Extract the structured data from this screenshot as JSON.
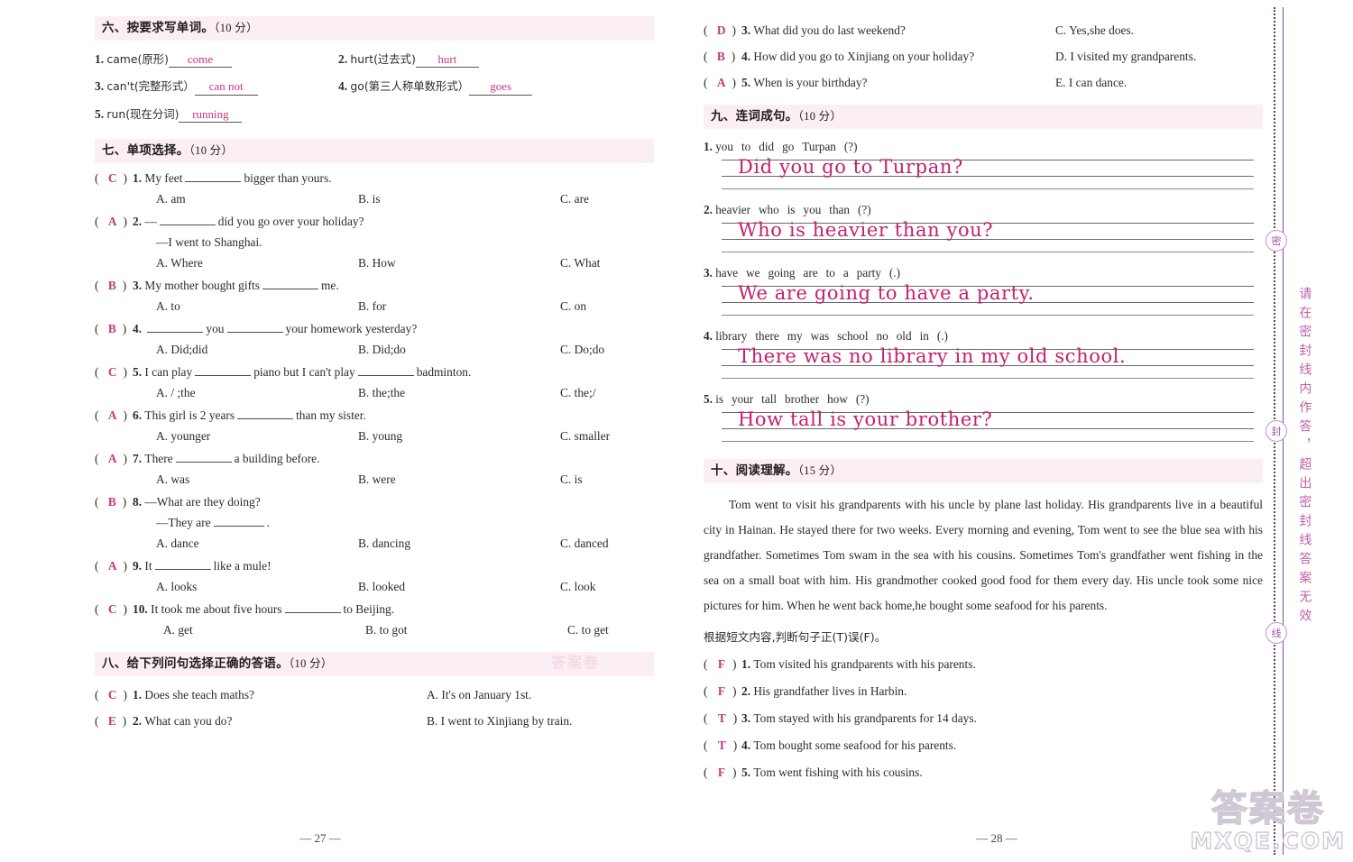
{
  "colors": {
    "answer_ink": "#c4377f",
    "handwriting_ink": "#c4206f",
    "section_bar_bg": "#fbeef4",
    "margin_text": "#c060a8"
  },
  "left_page": {
    "page_number": "— 27 —",
    "sections": [
      {
        "id": "six",
        "title": "六、按要求写单词。",
        "points": "（10 分）",
        "items": [
          {
            "num": "1.",
            "stem": "came(原形)",
            "answer": "come"
          },
          {
            "num": "2.",
            "stem": "hurt(过去式)",
            "answer": "hurt"
          },
          {
            "num": "3.",
            "stem": "can't(完整形式）",
            "answer": "can not"
          },
          {
            "num": "4.",
            "stem": "go(第三人称单数形式）",
            "answer": "goes"
          },
          {
            "num": "5.",
            "stem": "run(现在分词)",
            "answer": "running"
          }
        ]
      },
      {
        "id": "seven",
        "title": "七、单项选择。",
        "points": "（10 分）",
        "questions": [
          {
            "pick": "C",
            "num": "1.",
            "stem_before": "My feet",
            "stem_after": "bigger than yours.",
            "options": [
              "A. am",
              "B. is",
              "C. are"
            ]
          },
          {
            "pick": "A",
            "num": "2.",
            "stem_before": "—",
            "stem_after": "did you go over your holiday?",
            "sub": "—I went to Shanghai.",
            "options": [
              "A. Where",
              "B. How",
              "C. What"
            ]
          },
          {
            "pick": "B",
            "num": "3.",
            "stem_before": "My mother bought gifts",
            "stem_after": "me.",
            "options": [
              "A. to",
              "B. for",
              "C. on"
            ]
          },
          {
            "pick": "B",
            "num": "4.",
            "stem_before": "",
            "stem_mid": "you",
            "stem_after": "your homework yesterday?",
            "options": [
              "A. Did;did",
              "B. Did;do",
              "C. Do;do"
            ]
          },
          {
            "pick": "C",
            "num": "5.",
            "stem_before": "I can play",
            "stem_mid": "piano but I can't play",
            "stem_after": "badminton.",
            "options": [
              "A. / ;the",
              "B. the;the",
              "C. the;/"
            ]
          },
          {
            "pick": "A",
            "num": "6.",
            "stem_before": "This girl is 2 years",
            "stem_after": "than my sister.",
            "options": [
              "A. younger",
              "B. young",
              "C. smaller"
            ]
          },
          {
            "pick": "A",
            "num": "7.",
            "stem_before": "There",
            "stem_after": "a building before.",
            "options": [
              "A. was",
              "B. were",
              "C. is"
            ]
          },
          {
            "pick": "B",
            "num": "8.",
            "stem_before": "—What are they doing?",
            "sub": "—They are",
            "sub_after": ".",
            "options": [
              "A. dance",
              "B. dancing",
              "C. danced"
            ]
          },
          {
            "pick": "A",
            "num": "9.",
            "stem_before": "It",
            "stem_after": "like a mule!",
            "options": [
              "A. looks",
              "B. looked",
              "C. look"
            ]
          },
          {
            "pick": "C",
            "num": "10.",
            "stem_before": "It took me about five hours",
            "stem_after": "to Beijing.",
            "options": [
              "A. get",
              "B. to got",
              "C. to get"
            ]
          }
        ]
      },
      {
        "id": "eight",
        "title": "八、给下列问句选择正确的答语。",
        "points": "（10 分）",
        "rows": [
          {
            "pick": "C",
            "num": "1.",
            "question": "Does she teach maths?",
            "answer": "A. It's on January 1st."
          },
          {
            "pick": "E",
            "num": "2.",
            "question": "What can you do?",
            "answer": "B. I went to Xinjiang by train."
          }
        ]
      }
    ]
  },
  "right_page": {
    "page_number": "— 28 —",
    "eight_cont": {
      "rows": [
        {
          "pick": "D",
          "num": "3.",
          "question": "What did you do last weekend?",
          "answer": "C. Yes,she does."
        },
        {
          "pick": "B",
          "num": "4.",
          "question": "How did you go to Xinjiang on your holiday?",
          "answer": "D. I visited my grandparents."
        },
        {
          "pick": "A",
          "num": "5.",
          "question": "When is your birthday?",
          "answer": "E. I can dance."
        }
      ]
    },
    "sections": [
      {
        "id": "nine",
        "title": "九、连词成句。",
        "points": "（10 分）",
        "items": [
          {
            "num": "1.",
            "words": [
              "you",
              "to",
              "did",
              "go",
              "Turpan",
              "(?)"
            ],
            "answer": "Did you go to Turpan?"
          },
          {
            "num": "2.",
            "words": [
              "heavier",
              "who",
              "is",
              "you",
              "than",
              "(?)"
            ],
            "answer": "Who is heavier than you?"
          },
          {
            "num": "3.",
            "words": [
              "have",
              "we",
              "going",
              "are",
              "to",
              "a",
              "party",
              "(.)"
            ],
            "answer": "We are going to have a party."
          },
          {
            "num": "4.",
            "words": [
              "library",
              "there",
              "my",
              "was",
              "school",
              "no",
              "old",
              "in",
              "(.)"
            ],
            "answer": "There was no library in my old school."
          },
          {
            "num": "5.",
            "words": [
              "is",
              "your",
              "tall",
              "brother",
              "how",
              "(?)"
            ],
            "answer": "How tall is your brother?"
          }
        ]
      },
      {
        "id": "ten",
        "title": "十、阅读理解。",
        "points": "（15 分）",
        "passage": "Tom went to visit his grandparents with his uncle by plane last holiday. His grandparents live in a beautiful city in Hainan. He stayed there for two weeks. Every morning and evening, Tom went to see the blue sea with his grandfather. Sometimes Tom swam in the sea with his cousins. Sometimes Tom's grandfather went fishing in the sea on a small boat with him. His grandmother cooked good food for them every day. His uncle took some nice pictures for him. When he went back home,he bought some seafood for his parents.",
        "instruction": "根据短文内容,判断句子正(T)误(F)。",
        "tf_items": [
          {
            "pick": "F",
            "num": "1.",
            "text": "Tom visited his grandparents with his parents."
          },
          {
            "pick": "F",
            "num": "2.",
            "text": "His grandfather lives in Harbin."
          },
          {
            "pick": "T",
            "num": "3.",
            "text": "Tom stayed with his grandparents for 14 days."
          },
          {
            "pick": "T",
            "num": "4.",
            "text": "Tom bought some seafood for his parents."
          },
          {
            "pick": "F",
            "num": "5.",
            "text": "Tom went fishing with his cousins."
          }
        ]
      }
    ]
  },
  "margin": {
    "vertical_text": "请在密封线内作答，超出密封线答案无效",
    "seal_chars": [
      "密",
      "封",
      "线"
    ]
  },
  "watermark": {
    "brand_cn": "答案卷",
    "brand_domain": "MXQE.COM",
    "faint_cn": "答案卷"
  }
}
